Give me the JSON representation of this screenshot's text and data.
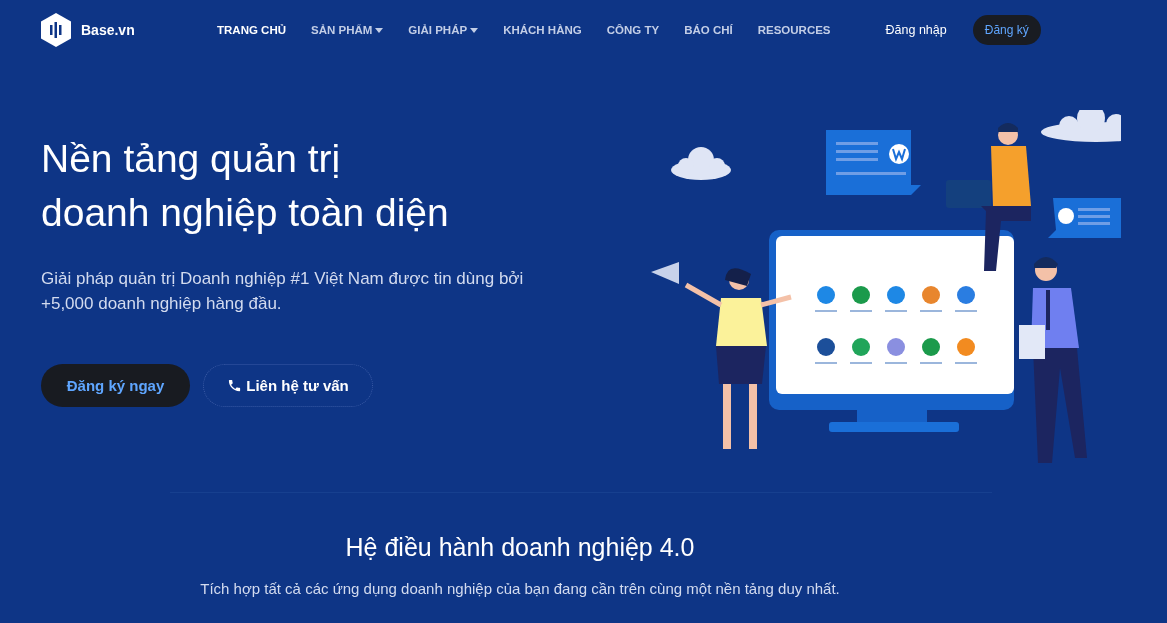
{
  "header": {
    "logo": "Base.vn",
    "nav": [
      {
        "label": "TRANG CHỦ",
        "selected": true,
        "has_dropdown": false
      },
      {
        "label": "SẢN PHẨM",
        "selected": false,
        "has_dropdown": true
      },
      {
        "label": "GIẢI PHÁP",
        "selected": false,
        "has_dropdown": true
      },
      {
        "label": "KHÁCH HÀNG",
        "selected": false,
        "has_dropdown": false
      },
      {
        "label": "CÔNG TY",
        "selected": false,
        "has_dropdown": false
      },
      {
        "label": "BÁO CHÍ",
        "selected": false,
        "has_dropdown": false
      },
      {
        "label": "RESOURCES",
        "selected": false,
        "has_dropdown": false
      }
    ],
    "login": "Đăng nhập",
    "signup": "Đăng ký"
  },
  "hero": {
    "title_lines": [
      "Nền tảng quản trị",
      "doanh nghiệp toàn diện"
    ],
    "subtitle": "Giải pháp quản trị Doanh nghiệp #1 Việt Nam được tin dùng bởi +5,000 doanh nghiệp hàng đầu.",
    "primary_button": "Đăng ký ngay",
    "secondary_button": "Liên hệ tư vấn"
  },
  "section": {
    "title": "Hệ điều hành doanh nghiệp 4.0",
    "subtitle": "Tích hợp tất cả các ứng dụng doanh nghiệp của bạn đang cần trên cùng một nền tảng duy nhất."
  }
}
